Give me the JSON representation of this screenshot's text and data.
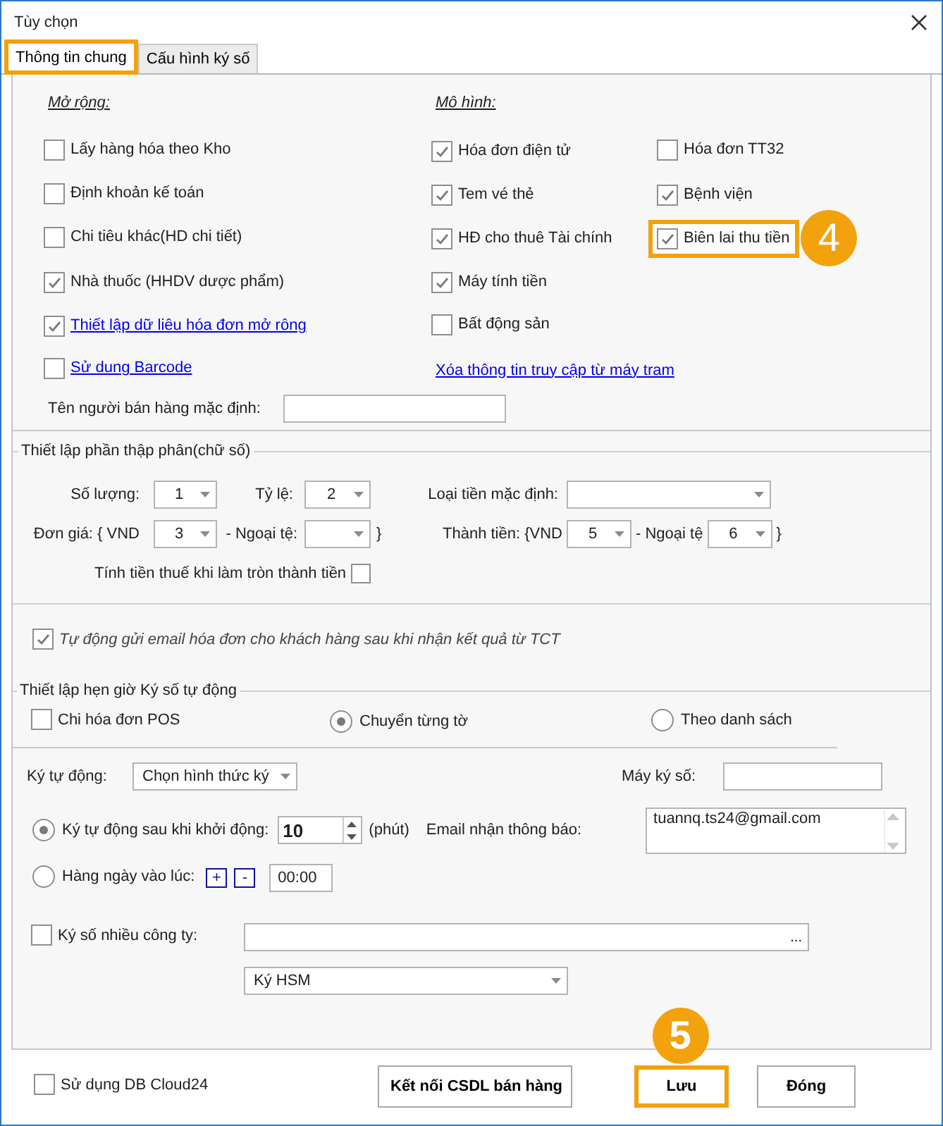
{
  "window": {
    "title": "Tùy chọn"
  },
  "tabs": [
    {
      "label": "Thông tin chung",
      "selected": true,
      "highlighted": true
    },
    {
      "label": "Cấu hình ký số",
      "selected": false,
      "highlighted": false
    }
  ],
  "extensions": {
    "heading": "Mở rộng:",
    "items": [
      {
        "kind": "checkbox",
        "label": "Lấy hàng hóa theo Kho",
        "checked": false
      },
      {
        "kind": "checkbox",
        "label": "Định khoản kế toán",
        "checked": false
      },
      {
        "kind": "checkbox",
        "label": "Chi tiêu khác(HD chi tiết)",
        "checked": false
      },
      {
        "kind": "checkbox",
        "label": "Nhà thuốc (HHDV dược phẩm)",
        "checked": true
      },
      {
        "kind": "link_checkbox",
        "label": "Thiết lập dữ liêu hóa đơn mở rông",
        "checked": true
      },
      {
        "kind": "link_checkbox",
        "label": "Sử dung Barcode",
        "checked": false
      }
    ]
  },
  "models": {
    "heading": "Mô hình:",
    "column_1": [
      {
        "kind": "checkbox",
        "label": "Hóa đơn điện tử",
        "checked": true
      },
      {
        "kind": "checkbox",
        "label": "Tem vé thẻ",
        "checked": true
      },
      {
        "kind": "checkbox",
        "label": "HĐ cho thuê Tài chính",
        "checked": true
      },
      {
        "kind": "checkbox",
        "label": "Máy tính tiền",
        "checked": true
      },
      {
        "kind": "checkbox",
        "label": "Bất động sản",
        "checked": false
      },
      {
        "kind": "link",
        "label": "Xóa thông tin truy cập từ máy tram"
      }
    ],
    "column_2": [
      {
        "label": "Hóa đơn TT32",
        "checked": false,
        "highlighted": false
      },
      {
        "label": "Bệnh viện",
        "checked": true,
        "highlighted": false
      },
      {
        "label": "Biên lai thu tiền",
        "checked": true,
        "highlighted": true,
        "callout": "4"
      }
    ]
  },
  "seller": {
    "label": "Tên người bán hàng mặc định:"
  },
  "decimals": {
    "title": "Thiết lập phần thập phân(chữ số)",
    "quantity": {
      "label": "Số lượng:",
      "value": "1"
    },
    "rate": {
      "label": "Tỷ lệ:",
      "value": "2"
    },
    "default_currency": {
      "label": "Loại tiền mặc định:"
    },
    "unit_price": {
      "label": "Đơn giá: { VND",
      "value": "3",
      "foreign_label": "- Ngoại tệ:",
      "close": "}"
    },
    "amount": {
      "label": "Thành tiền: {VND",
      "value": "5",
      "foreign_label": "- Ngoại tệ",
      "foreign_value": "6",
      "close": "}"
    },
    "tax_rounding": {
      "label": "Tính tiền thuế khi làm tròn thành tiền",
      "checked": false
    }
  },
  "auto_email": {
    "label": "Tự động gửi email hóa đơn cho khách hàng sau khi nhận kết quả từ TCT",
    "checked": true
  },
  "auto_sign": {
    "title": "Thiết lập hẹn giờ Ký số tự động",
    "pos_only": {
      "label": "Chi hóa đơn POS",
      "checked": false
    },
    "modes": [
      {
        "label": "Chuyển từng tờ",
        "selected": true
      },
      {
        "label": "Theo danh sách",
        "selected": false
      }
    ],
    "sign_method": {
      "label": "Ký tự động:",
      "value": "Chọn hình thức ký"
    },
    "signer": {
      "label": "Máy ký số:"
    },
    "schedule": [
      {
        "kind": "after_start",
        "label": "Ký tự động sau khi khởi động:",
        "selected": true,
        "value": "10",
        "unit": "(phút)"
      },
      {
        "kind": "daily",
        "label": "Hàng ngày vào lúc:",
        "selected": false,
        "plus": "+",
        "minus": "-",
        "value": "00:00"
      }
    ],
    "email": {
      "label": "Email nhận thông báo:",
      "value": "tuannq.ts24@gmail.com"
    },
    "multi_company": {
      "label": "Ký số nhiều công ty:",
      "checked": false,
      "browse": "..."
    },
    "hsm": {
      "value": "Ký HSM"
    }
  },
  "footer": {
    "cloud": {
      "label": "Sử dụng DB Cloud24",
      "checked": false
    },
    "buttons": [
      {
        "label": "Kết nối CSDL bán hàng",
        "highlighted": false
      },
      {
        "label": "Lưu",
        "highlighted": true,
        "callout": "5"
      },
      {
        "label": "Đóng",
        "highlighted": false
      }
    ]
  }
}
